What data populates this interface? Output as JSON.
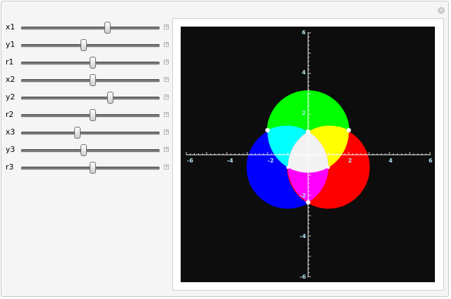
{
  "controls": [
    {
      "label": "x1",
      "value": 0.63
    },
    {
      "label": "y1",
      "value": 0.45
    },
    {
      "label": "r1",
      "value": 0.52
    },
    {
      "label": "x2",
      "value": 0.52
    },
    {
      "label": "y2",
      "value": 0.65
    },
    {
      "label": "r2",
      "value": 0.52
    },
    {
      "label": "x3",
      "value": 0.4
    },
    {
      "label": "y3",
      "value": 0.45
    },
    {
      "label": "r3",
      "value": 0.52
    }
  ],
  "plot": {
    "background": "#0d0d0d",
    "axis_color": "#ffffff",
    "tick_label_color": "#b0e0f0",
    "x_ticks": [
      "-6",
      "-4",
      "-2",
      "2",
      "4",
      "6"
    ],
    "y_ticks": [
      "6",
      "4",
      "2",
      "-2",
      "-4",
      "-6"
    ],
    "circle_colors": {
      "green": "#00ff00",
      "blue": "#0000ff",
      "red": "#ff0000"
    }
  }
}
